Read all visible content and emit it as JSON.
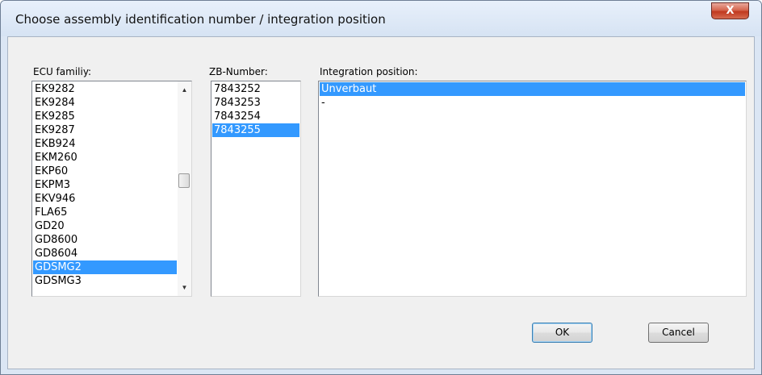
{
  "window": {
    "title": "Choose assembly identification number / integration position",
    "close_glyph": "X"
  },
  "ecu_family": {
    "label": "ECU familiy:",
    "items": [
      "EK9282",
      "EK9284",
      "EK9285",
      "EK9287",
      "EKB924",
      "EKM260",
      "EKP60",
      "EKPM3",
      "EKV946",
      "FLA65",
      "GD20",
      "GD8600",
      "GD8604",
      "GDSMG2",
      "GDSMG3"
    ],
    "selected": "GDSMG2",
    "scroll_position": 0.45
  },
  "zb_number": {
    "label": "ZB-Number:",
    "items": [
      "7843252",
      "7843253",
      "7843254",
      "7843255"
    ],
    "selected": "7843255"
  },
  "integration_position": {
    "label": "Integration position:",
    "items": [
      "Unverbaut",
      "-"
    ],
    "selected": "Unverbaut"
  },
  "buttons": {
    "ok": "OK",
    "cancel": "Cancel"
  },
  "colors": {
    "selection": "#3399ff",
    "close_button": "#c7452c"
  }
}
